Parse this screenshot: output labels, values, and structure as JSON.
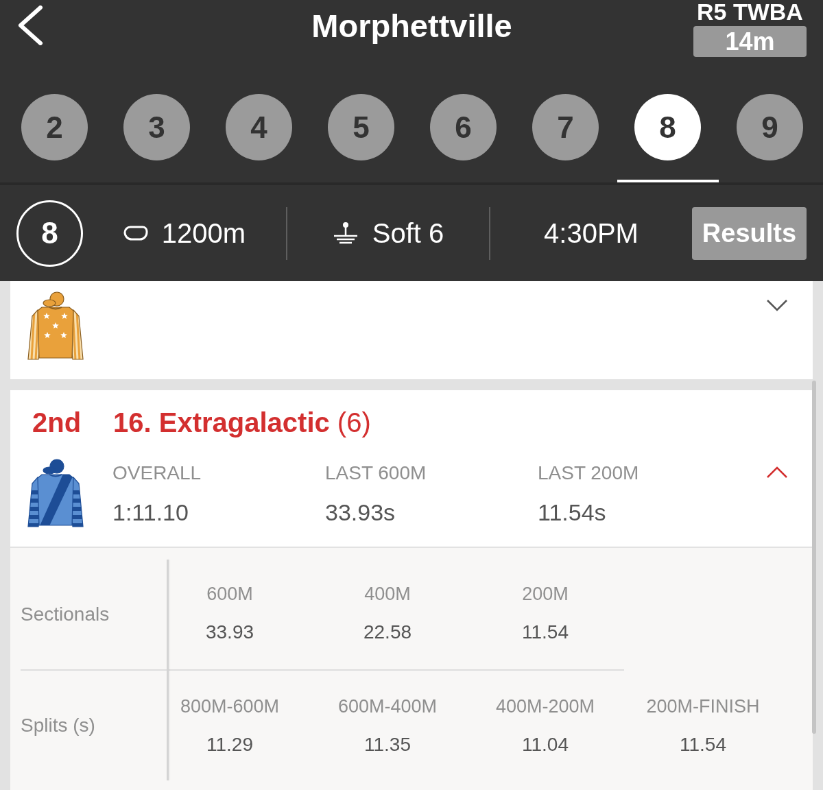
{
  "header": {
    "title": "Morphettville",
    "next_race": "R5 TWBA",
    "countdown": "14m"
  },
  "race_tabs": [
    {
      "label": "2",
      "selected": false
    },
    {
      "label": "3",
      "selected": false
    },
    {
      "label": "4",
      "selected": false
    },
    {
      "label": "5",
      "selected": false
    },
    {
      "label": "6",
      "selected": false
    },
    {
      "label": "7",
      "selected": false
    },
    {
      "label": "8",
      "selected": true
    },
    {
      "label": "9",
      "selected": false
    }
  ],
  "race_info": {
    "race_number": "8",
    "distance": "1200m",
    "track_condition": "Soft 6",
    "start_time": "4:30PM",
    "results_button": "Results"
  },
  "runners": [
    {
      "silks": {
        "kind": "stars"
      },
      "expanded": false
    },
    {
      "silks": {
        "kind": "sash"
      },
      "expanded": true,
      "placing": "2nd",
      "name": "**16. Extragalactic** (6)",
      "stats": [
        {
          "label": "OVERALL",
          "value": "1:11.10"
        },
        {
          "label": "LAST 600M",
          "value": "33.93s"
        },
        {
          "label": "LAST 200M",
          "value": "11.54s"
        }
      ],
      "sectionals": {
        "label": "Sectionals",
        "items": [
          {
            "distance": "600M",
            "time": "33.93"
          },
          {
            "distance": "400M",
            "time": "22.58"
          },
          {
            "distance": "200M",
            "time": "11.54"
          }
        ]
      },
      "splits": {
        "label": "Splits (s)",
        "items": [
          {
            "distance": "800M-600M",
            "time": "11.29"
          },
          {
            "distance": "600M-400M",
            "time": "11.35"
          },
          {
            "distance": "400M-200M",
            "time": "11.04"
          },
          {
            "distance": "200M-FINISH",
            "time": "11.54"
          }
        ]
      }
    }
  ]
}
